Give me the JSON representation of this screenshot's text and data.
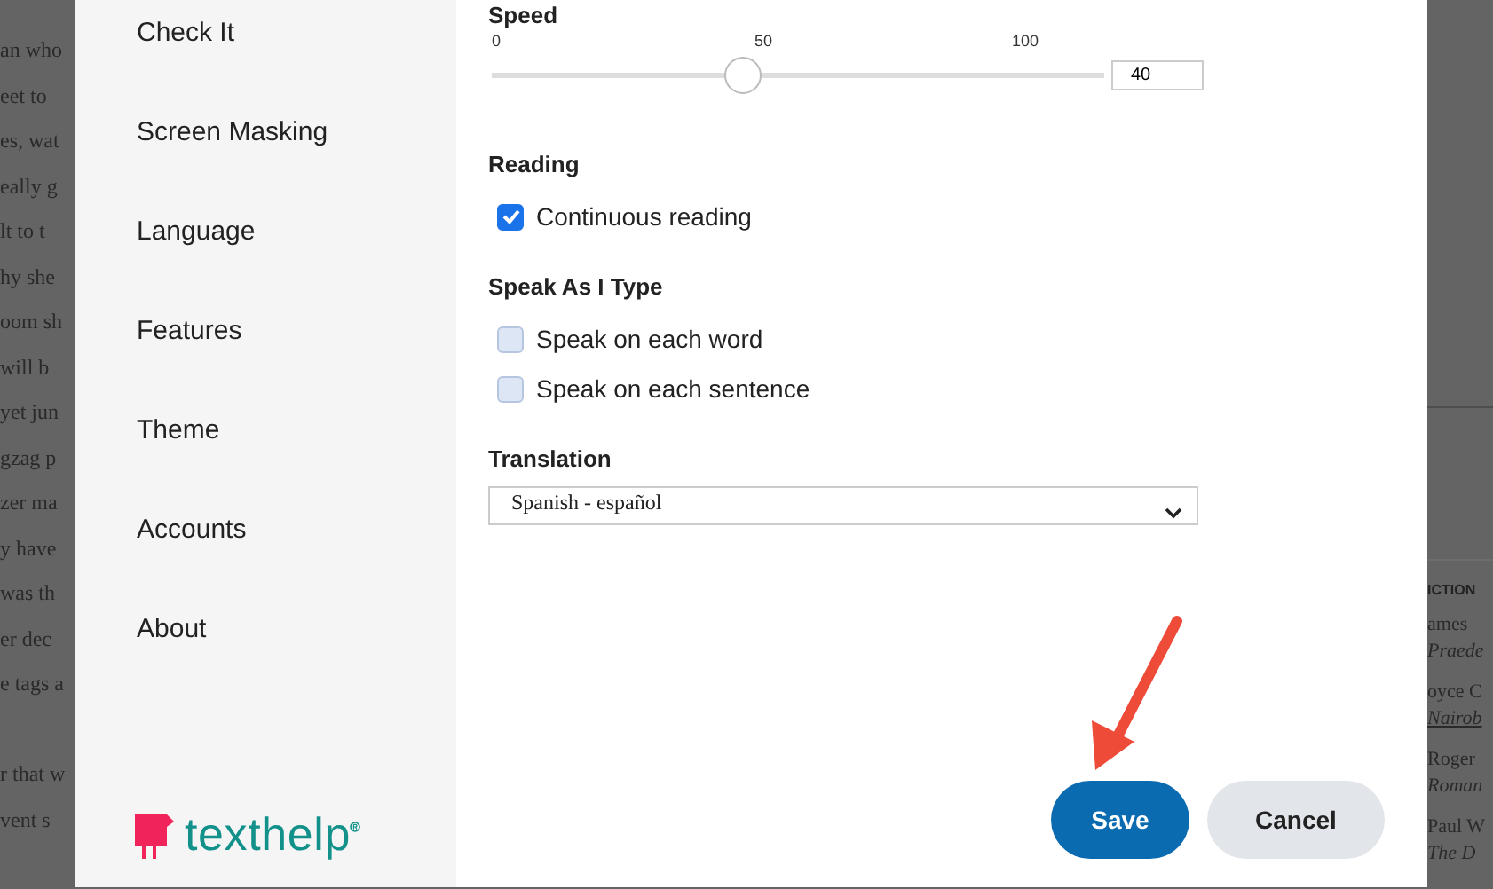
{
  "background_page": {
    "left_lines": [
      "an who",
      "eet to",
      "es, wat",
      "eally g",
      "lt to t",
      "hy she",
      "oom sh",
      "will b",
      "yet jun",
      "gzag p",
      "zer ma",
      "y have",
      "was th",
      "er dec",
      "e tags a"
    ],
    "left_lines_lower": [
      "r that w",
      "vent s"
    ],
    "right_heading": "ICTION",
    "right_entries": [
      {
        "author": "ames",
        "title": "Praede",
        "underlined": false
      },
      {
        "author": "oyce C",
        "title": "Nairob",
        "underlined": true
      },
      {
        "author": "Roger",
        "title": "Roman",
        "underlined": false
      },
      {
        "author": "Paul W",
        "title": "The D",
        "underlined": false
      }
    ]
  },
  "sidebar": {
    "items": [
      {
        "label": "Check It"
      },
      {
        "label": "Screen Masking"
      },
      {
        "label": "Language"
      },
      {
        "label": "Features"
      },
      {
        "label": "Theme"
      },
      {
        "label": "Accounts"
      },
      {
        "label": "About"
      }
    ],
    "logo_text": "texthelp"
  },
  "speed": {
    "heading": "Speed",
    "ticks": [
      "0",
      "50",
      "100"
    ],
    "level": 0.41,
    "value": "40"
  },
  "reading": {
    "heading": "Reading",
    "options": [
      {
        "label": "Continuous reading",
        "checked": true
      }
    ]
  },
  "speak_as_i_type": {
    "heading": "Speak As I Type",
    "options": [
      {
        "label": "Speak on each word",
        "checked": false
      },
      {
        "label": "Speak on each sentence",
        "checked": false
      }
    ]
  },
  "translation": {
    "heading": "Translation",
    "value": "Spanish - español"
  },
  "buttons": {
    "save": "Save",
    "cancel": "Cancel"
  }
}
